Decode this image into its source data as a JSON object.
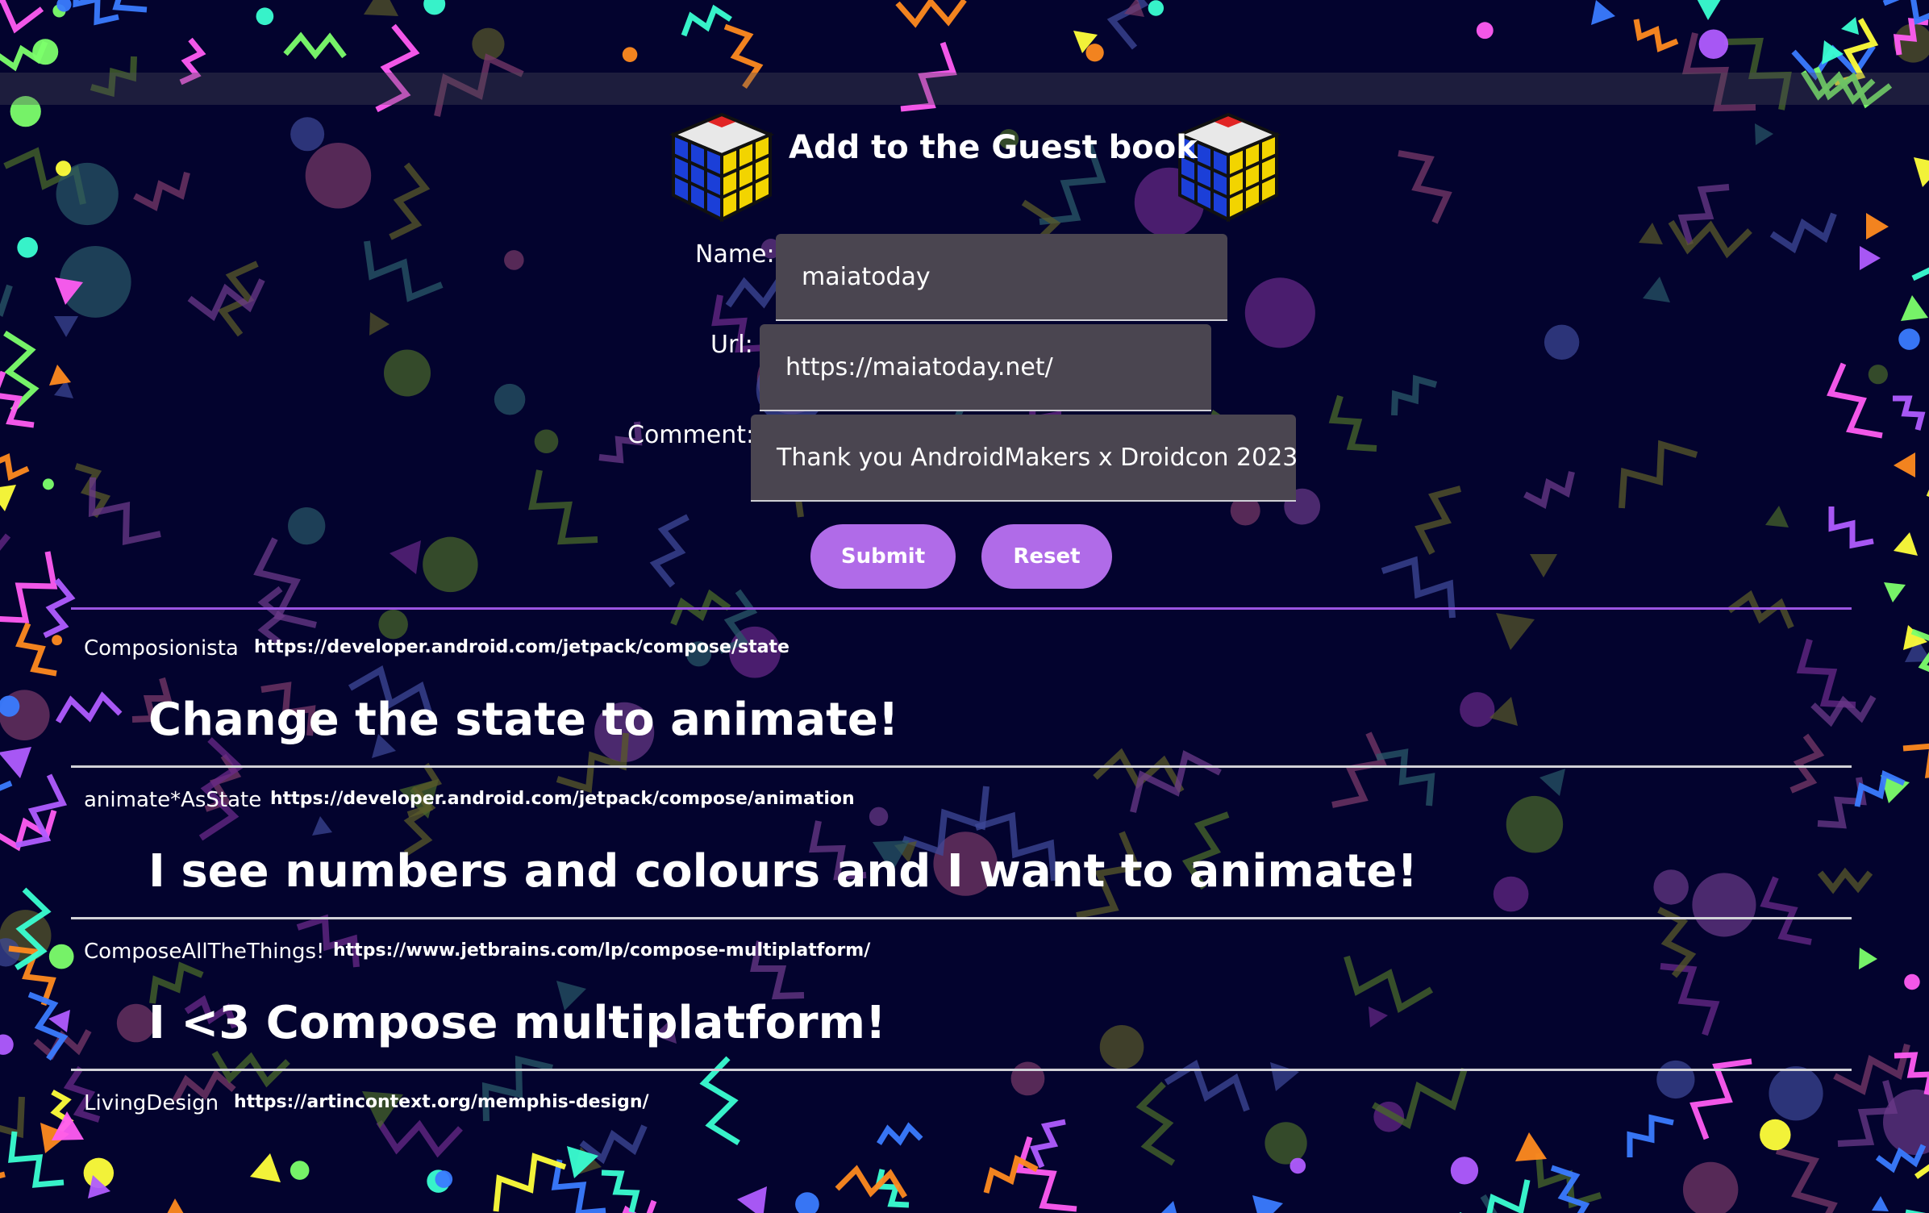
{
  "form": {
    "title": "Add to the Guest book",
    "name_label": "Name:",
    "name_value": "maiatoday",
    "url_label": "Url:",
    "url_value": "https://maiatoday.net/",
    "comment_label": "Comment:",
    "comment_value": "Thank you AndroidMakers x Droidcon 2023",
    "submit_label": "Submit",
    "reset_label": "Reset"
  },
  "entries": [
    {
      "author": "Composionista",
      "url": "https://developer.android.com/jetpack/compose/state",
      "comment": "Change the state to animate!"
    },
    {
      "author": "animate*AsState",
      "url": "https://developer.android.com/jetpack/compose/animation",
      "comment": "I see numbers and colours and I want to animate!"
    },
    {
      "author": "ComposeAllTheThings!",
      "url": "https://www.jetbrains.com/lp/compose-multiplatform/",
      "comment": "I <3 Compose multiplatform!"
    },
    {
      "author": "LivingDesign",
      "url": "https://artincontext.org/memphis-design/",
      "comment": ""
    }
  ],
  "icons": {
    "left_cube": "rubiks-cube-icon",
    "right_cube": "rubiks-cube-icon"
  },
  "colors": {
    "background": "#03032e",
    "accent": "#b06be8",
    "field": "#4a4550"
  }
}
